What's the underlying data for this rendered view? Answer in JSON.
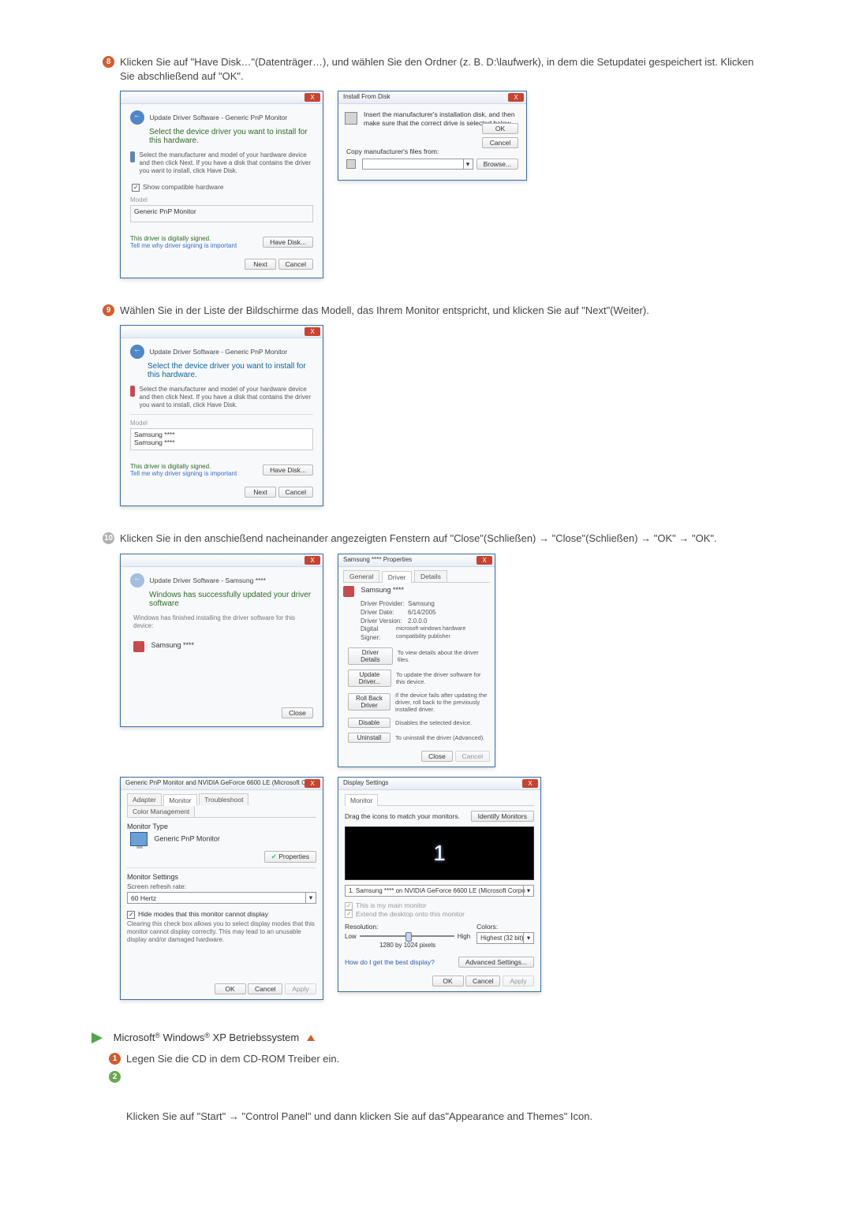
{
  "step8": {
    "bullet": "8",
    "text": "Klicken Sie auf \"Have Disk…\"(Datenträger…), und wählen Sie den Ordner (z. B. D:\\laufwerk), in dem die Setupdatei gespeichert ist. Klicken Sie abschließend auf \"OK\".",
    "winA": {
      "breadcrumb": "Update Driver Software - Generic PnP Monitor",
      "header": "Select the device driver you want to install for this hardware.",
      "sub": "Select the manufacturer and model of your hardware device and then click Next. If you have a disk that contains the driver you want to install, click Have Disk.",
      "checkbox": "Show compatible hardware",
      "col_model": "Model",
      "model1": "Generic PnP Monitor",
      "signed": "This driver is digitally signed.",
      "signed_link": "Tell me why driver signing is important",
      "have_disk": "Have Disk...",
      "next": "Next",
      "cancel": "Cancel"
    },
    "winB": {
      "title": "Install From Disk",
      "msg": "Insert the manufacturer's installation disk, and then make sure that the correct drive is selected below.",
      "ok": "OK",
      "cancel": "Cancel",
      "cmf": "Copy manufacturer's files from:",
      "browse": "Browse..."
    }
  },
  "step9": {
    "bullet": "9",
    "text": "Wählen Sie in der Liste der Bildschirme das Modell, das Ihrem Monitor entspricht, und klicken Sie auf \"Next\"(Weiter).",
    "win": {
      "breadcrumb": "Update Driver Software - Generic PnP Monitor",
      "header": "Select the device driver you want to install for this hardware.",
      "sub": "Select the manufacturer and model of your hardware device and then click Next. If you have a disk that contains the driver you want to install, click Have Disk.",
      "col_model": "Model",
      "m1": "Samsung ****",
      "m2": "Samsung ****",
      "signed": "This driver is digitally signed.",
      "signed_link": "Tell me why driver signing is important",
      "have_disk": "Have Disk...",
      "next": "Next",
      "cancel": "Cancel"
    }
  },
  "step10": {
    "bullet": "10",
    "text": "Klicken Sie in den anschießend nacheinander angezeigten Fenstern auf \"Close\"(Schließen) → \"Close\"(Schließen) → \"OK\" → \"OK\".",
    "winA": {
      "breadcrumb": "Update Driver Software - Samsung ****",
      "header": "Windows has successfully updated your driver software",
      "line": "Windows has finished installing the driver software for this device:",
      "model": "Samsung ****",
      "close": "Close"
    },
    "winB": {
      "title": "Samsung **** Properties",
      "tabs": {
        "general": "General",
        "driver": "Driver",
        "details": "Details"
      },
      "model": "Samsung ****",
      "kv": {
        "provider_k": "Driver Provider:",
        "provider_v": "Samsung",
        "date_k": "Driver Date:",
        "date_v": "6/14/2005",
        "ver_k": "Driver Version:",
        "ver_v": "2.0.0.0",
        "signer_k": "Digital Signer:",
        "signer_v": "microsoft windows hardware compatibility publisher"
      },
      "actions": {
        "details": "Driver Details",
        "details_d": "To view details about the driver files.",
        "update": "Update Driver...",
        "update_d": "To update the driver software for this device.",
        "rollback": "Roll Back Driver",
        "rollback_d": "If the device fails after updating the driver, roll back to the previously installed driver.",
        "disable": "Disable",
        "disable_d": "Disables the selected device.",
        "uninstall": "Uninstall",
        "uninstall_d": "To uninstall the driver (Advanced)."
      },
      "close": "Close",
      "cancel": "Cancel"
    },
    "winC": {
      "title": "Generic PnP Monitor and NVIDIA GeForce 6600 LE (Microsoft Co...",
      "tabs": {
        "adapter": "Adapter",
        "monitor": "Monitor",
        "trouble": "Troubleshoot",
        "color": "Color Management"
      },
      "mt": "Monitor Type",
      "mt_name": "Generic PnP Monitor",
      "props": "Properties",
      "ms": "Monitor Settings",
      "srr": "Screen refresh rate:",
      "hz": "60 Hertz",
      "hide": "Hide modes that this monitor cannot display",
      "hide_d": "Clearing this check box allows you to select display modes that this monitor cannot display correctly. This may lead to an unusable display and/or damaged hardware.",
      "ok": "OK",
      "cancel": "Cancel",
      "apply": "Apply"
    },
    "winD": {
      "title": "Display Settings",
      "tab": "Monitor",
      "drag": "Drag the icons to match your monitors.",
      "identify": "Identify Monitors",
      "device": "1. Samsung **** on NVIDIA GeForce 6600 LE (Microsoft Corpo",
      "chk1": "This is my main monitor",
      "chk2": "Extend the desktop onto this monitor",
      "res": "Resolution:",
      "low": "Low",
      "high": "High",
      "res_val": "1280 by 1024 pixels",
      "colors": "Colors:",
      "colors_val": "Highest (32 bit)",
      "best": "How do I get the best display?",
      "adv": "Advanced Settings...",
      "ok": "OK",
      "cancel": "Cancel",
      "apply": "Apply"
    }
  },
  "xp": {
    "heading_pre": "Microsoft",
    "heading_mid": " Windows",
    "heading_post": " XP Betriebssystem",
    "reg": "®",
    "s1": {
      "n": "1",
      "text": "Legen Sie die CD in dem CD-ROM Treiber ein."
    },
    "s2": {
      "n": "2"
    },
    "para": "Klicken Sie auf \"Start\" → \"Control Panel\" und dann klicken Sie auf das\"Appearance and Themes\" Icon."
  }
}
